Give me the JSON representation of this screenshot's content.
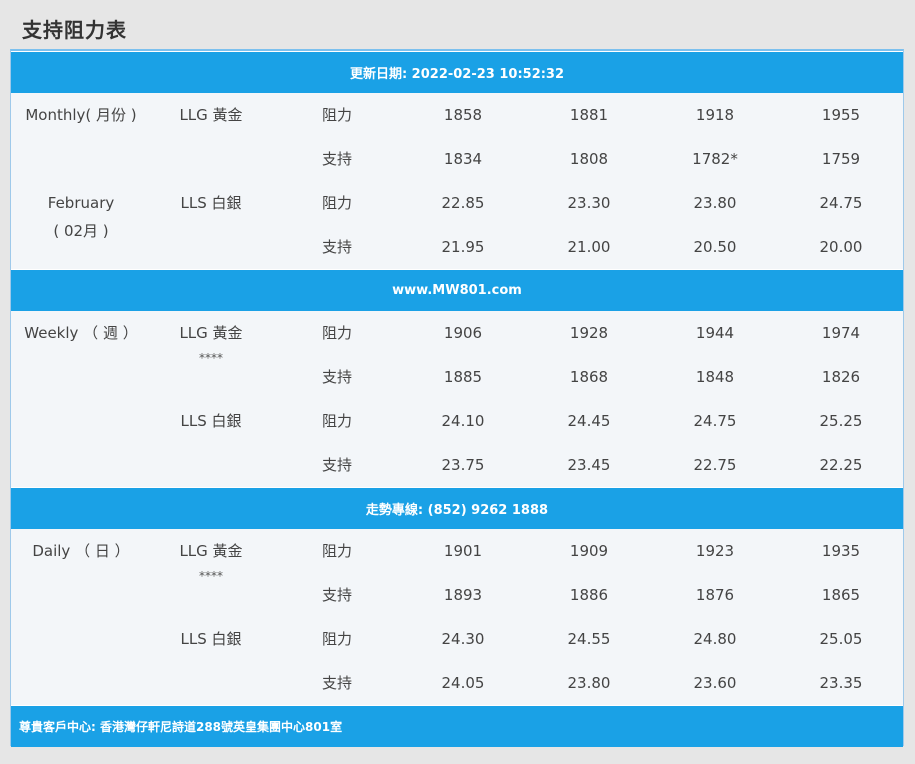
{
  "page_title": "支持阻力表",
  "bands": {
    "update": "更新日期: 2022-02-23 10:52:32",
    "website": "www.MW801.com",
    "hotline": "走勢專線: (852) 9262 1888",
    "address": "尊貴客戶中心: 香港灣仔軒尼詩道288號英皇集團中心801室"
  },
  "sections": [
    {
      "period": "Monthly( 月份 )",
      "period_sub": "February",
      "period_sub2": "( 02月 )",
      "groups": [
        {
          "metal": "LLG 黃金",
          "stars": "",
          "rows": [
            {
              "type": "阻力",
              "values": [
                "1858",
                "1881",
                "1918",
                "1955"
              ]
            },
            {
              "type": "支持",
              "values": [
                "1834",
                "1808",
                "1782*",
                "1759"
              ]
            }
          ]
        },
        {
          "metal": "LLS 白銀",
          "stars": "",
          "rows": [
            {
              "type": "阻力",
              "values": [
                "22.85",
                "23.30",
                "23.80",
                "24.75"
              ]
            },
            {
              "type": "支持",
              "values": [
                "21.95",
                "21.00",
                "20.50",
                "20.00"
              ]
            }
          ]
        }
      ]
    },
    {
      "period": "Weekly （ 週 ）",
      "groups": [
        {
          "metal": "LLG 黃金",
          "stars": "****",
          "rows": [
            {
              "type": "阻力",
              "values": [
                "1906",
                "1928",
                "1944",
                "1974"
              ]
            },
            {
              "type": "支持",
              "values": [
                "1885",
                "1868",
                "1848",
                "1826"
              ]
            }
          ]
        },
        {
          "metal": "LLS 白銀",
          "stars": "",
          "rows": [
            {
              "type": "阻力",
              "values": [
                "24.10",
                "24.45",
                "24.75",
                "25.25"
              ]
            },
            {
              "type": "支持",
              "values": [
                "23.75",
                "23.45",
                "22.75",
                "22.25"
              ]
            }
          ]
        }
      ]
    },
    {
      "period": "Daily （ 日 ）",
      "groups": [
        {
          "metal": "LLG 黃金",
          "stars": "****",
          "rows": [
            {
              "type": "阻力",
              "values": [
                "1901",
                "1909",
                "1923",
                "1935"
              ]
            },
            {
              "type": "支持",
              "values": [
                "1893",
                "1886",
                "1876",
                "1865"
              ]
            }
          ]
        },
        {
          "metal": "LLS 白銀",
          "stars": "",
          "rows": [
            {
              "type": "阻力",
              "values": [
                "24.30",
                "24.55",
                "24.80",
                "25.05"
              ]
            },
            {
              "type": "支持",
              "values": [
                "24.05",
                "23.80",
                "23.60",
                "23.35"
              ]
            }
          ]
        }
      ]
    }
  ]
}
